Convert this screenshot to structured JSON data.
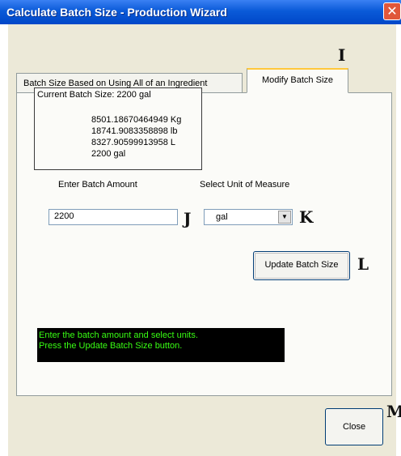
{
  "window": {
    "title": "Calculate Batch Size - Production Wizard",
    "close_glyph": "✕"
  },
  "tabs": [
    {
      "label": "Batch Size Based on Using All of an Ingredient"
    },
    {
      "label": "Modify Batch Size"
    }
  ],
  "current_batch": {
    "title": "Current Batch Size: 2200 gal",
    "conversions": [
      "8501.18670464949 Kg",
      "18741.9083358898 lb",
      "8327.90599913958 L",
      "2200 gal"
    ]
  },
  "form": {
    "amount_label": "Enter Batch Amount",
    "amount_value": "2200",
    "unit_label": "Select Unit of Measure",
    "unit_value": "gal",
    "update_button": "Update Batch Size"
  },
  "status": {
    "line1": "Enter the batch amount and select units.",
    "line2": "Press the Update Batch Size button."
  },
  "close_button": "Close",
  "markers": {
    "i": "I",
    "j": "J",
    "k": "K",
    "l": "L",
    "m": "M"
  }
}
